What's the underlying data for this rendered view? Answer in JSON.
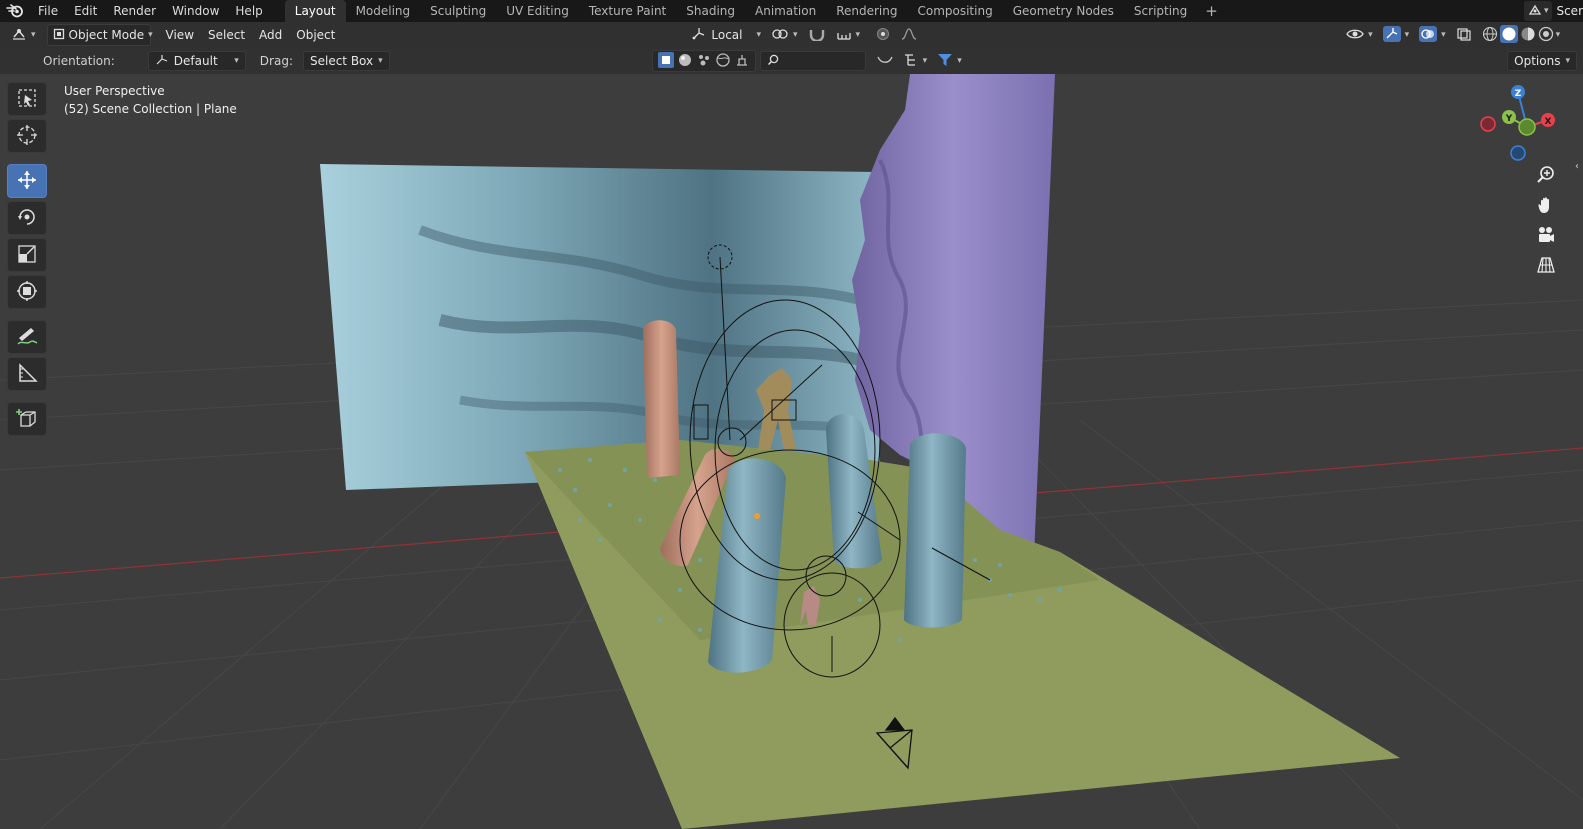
{
  "menu": [
    "File",
    "Edit",
    "Render",
    "Window",
    "Help"
  ],
  "workspaces": [
    {
      "label": "Layout",
      "active": true
    },
    {
      "label": "Modeling"
    },
    {
      "label": "Sculpting"
    },
    {
      "label": "UV Editing"
    },
    {
      "label": "Texture Paint"
    },
    {
      "label": "Shading"
    },
    {
      "label": "Animation"
    },
    {
      "label": "Rendering"
    },
    {
      "label": "Compositing"
    },
    {
      "label": "Geometry Nodes"
    },
    {
      "label": "Scripting"
    }
  ],
  "scene_selector": {
    "label": "Scer"
  },
  "header": {
    "mode": "Object Mode",
    "menus": [
      "View",
      "Select",
      "Add",
      "Object"
    ],
    "pivot": "Local"
  },
  "tool_options": {
    "orientation_label": "Orientation:",
    "orientation_value": "Default",
    "drag_label": "Drag:",
    "drag_value": "Select Box",
    "options_label": "Options"
  },
  "viewport": {
    "perspective": "User Perspective",
    "collection": "(52) Scene Collection | Plane"
  },
  "gizmo": {
    "x": "X",
    "y": "Y",
    "z": "Z"
  },
  "tools": [
    {
      "name": "select-box-tool",
      "icon": "select-box-icon",
      "active": false
    },
    {
      "name": "cursor-tool",
      "icon": "cursor-icon",
      "active": false
    },
    {
      "name": "move-tool",
      "icon": "move-icon",
      "active": true
    },
    {
      "name": "rotate-tool",
      "icon": "rotate-icon",
      "active": false
    },
    {
      "name": "scale-tool",
      "icon": "scale-icon",
      "active": false
    },
    {
      "name": "transform-tool",
      "icon": "transform-icon",
      "active": false
    },
    {
      "name": "annotate-tool",
      "icon": "annotate-icon",
      "active": false
    },
    {
      "name": "measure-tool",
      "icon": "measure-icon",
      "active": false
    },
    {
      "name": "add-cube-tool",
      "icon": "add-cube-icon",
      "active": false
    }
  ],
  "colors": {
    "accent": "#4772b3",
    "background": "#3d3d3d",
    "x_axis": "#e8414e",
    "y_axis": "#8bc34a",
    "z_axis": "#3b82d6",
    "ground": "#8c9a5c",
    "water": "#a8ccd6",
    "cliff": "#8477b5",
    "stone_blue": "#6d93a3",
    "stone_pink": "#c9937d"
  }
}
